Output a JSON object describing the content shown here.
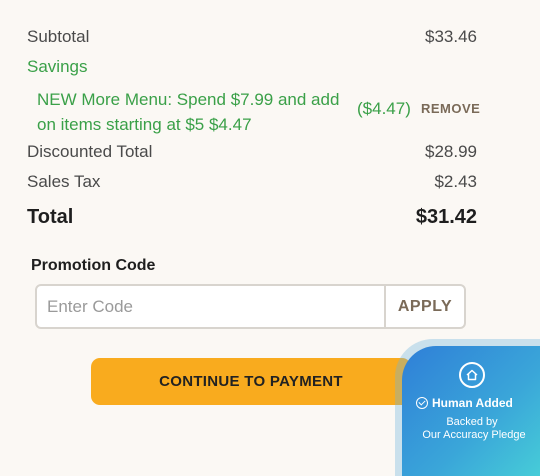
{
  "summary": {
    "subtotal_label": "Subtotal",
    "subtotal_value": "$33.46",
    "savings_label": "Savings",
    "discount_description": "NEW More Menu: Spend $7.99 and add on items starting at $5 $4.47",
    "discount_amount": "($4.47)",
    "remove_label": "REMOVE",
    "discounted_total_label": "Discounted Total",
    "discounted_total_value": "$28.99",
    "sales_tax_label": "Sales Tax",
    "sales_tax_value": "$2.43",
    "total_label": "Total",
    "total_value": "$31.42"
  },
  "promo": {
    "title": "Promotion Code",
    "placeholder": "Enter Code",
    "apply_label": "APPLY"
  },
  "checkout": {
    "continue_label": "CONTINUE TO PAYMENT"
  },
  "badge": {
    "title": "Human Added",
    "line1": "Backed by",
    "line2": "Our Accuracy Pledge",
    "icon": "home-icon"
  },
  "colors": {
    "accent_green": "#3aa048",
    "button_orange": "#f9ab1e",
    "badge_blue": "#2f7fd8",
    "badge_teal": "#49d4d8",
    "background": "#fbf8f4"
  }
}
